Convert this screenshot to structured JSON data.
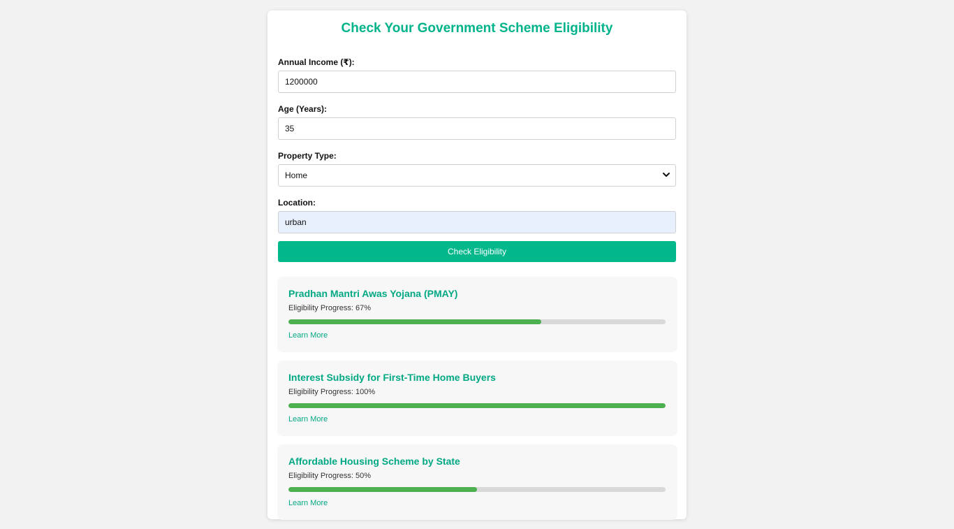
{
  "page": {
    "title": "Check Your Government Scheme Eligibility"
  },
  "form": {
    "income_label": "Annual Income (₹):",
    "income_value": "1200000",
    "age_label": "Age (Years):",
    "age_value": "35",
    "property_label": "Property Type:",
    "property_value": "Home",
    "location_label": "Location:",
    "location_value": "urban",
    "submit_label": "Check Eligibility"
  },
  "schemes": [
    {
      "name": "Pradhan Mantri Awas Yojana (PMAY)",
      "progress_text": "Eligibility Progress: 67%",
      "progress": 67,
      "link": "Learn More"
    },
    {
      "name": "Interest Subsidy for First-Time Home Buyers",
      "progress_text": "Eligibility Progress: 100%",
      "progress": 100,
      "link": "Learn More"
    },
    {
      "name": "Affordable Housing Scheme by State",
      "progress_text": "Eligibility Progress: 50%",
      "progress": 50,
      "link": "Learn More"
    }
  ],
  "colors": {
    "accent": "#00b88c",
    "progress_fill": "#4caf50",
    "progress_track": "#d9d9d9"
  }
}
